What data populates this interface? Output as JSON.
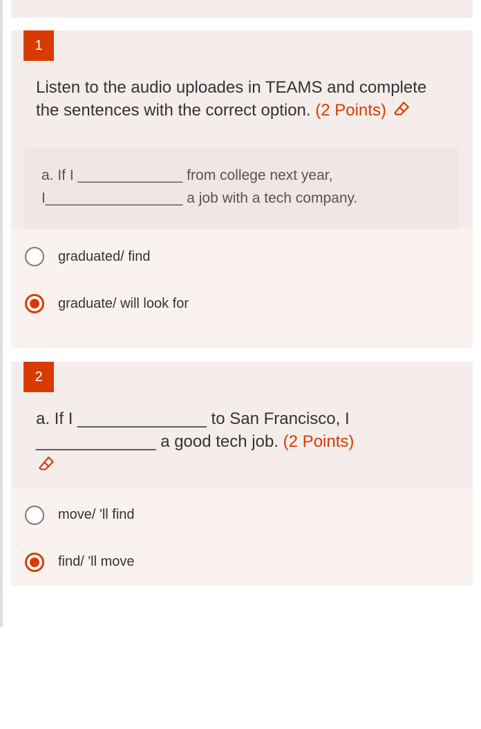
{
  "questions": [
    {
      "number": "1",
      "prompt_main": "Listen to the audio uploades in TEAMS and complete the sentences with the correct option.",
      "points_label": "(2 Points)",
      "sub_prompt": "a.      If I _____________ from college next year, I_________________ a job with a tech company.",
      "options": [
        {
          "label": "graduated/ find",
          "selected": false
        },
        {
          "label": "graduate/ will look for",
          "selected": true
        }
      ]
    },
    {
      "number": "2",
      "prompt_main": "a.      If I ______________ to San Francisco, I _____________ a good tech job.",
      "points_label": "(2 Points)",
      "sub_prompt": "",
      "options": [
        {
          "label": "move/ 'll find",
          "selected": false
        },
        {
          "label": "find/ 'll move",
          "selected": true
        }
      ]
    }
  ]
}
